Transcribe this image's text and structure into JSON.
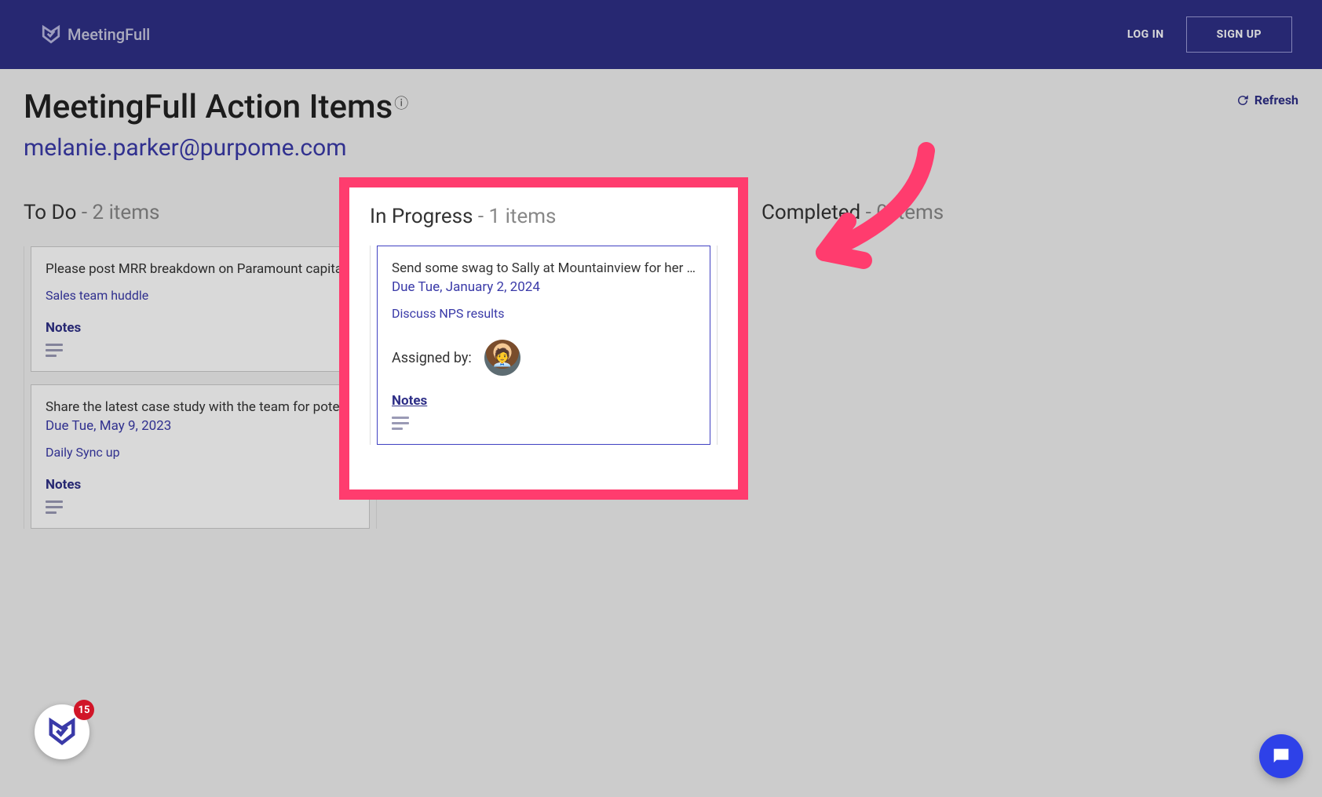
{
  "brand": "MeetingFull",
  "header": {
    "login": "LOG IN",
    "signup": "SIGN UP"
  },
  "page_title": "MeetingFull Action Items",
  "refresh_label": "Refresh",
  "email": "melanie.parker@purpome.com",
  "columns": {
    "todo": {
      "name": "To Do",
      "count_label": " - 2 items",
      "cards": [
        {
          "title": "Please post MRR breakdown on Paramount capital",
          "meeting": "Sales team huddle",
          "notes_label": "Notes"
        },
        {
          "title": "Share the latest case study with the team for potential us...",
          "due": "Due Tue, May 9, 2023",
          "meeting": "Daily Sync up",
          "notes_label": "Notes"
        }
      ]
    },
    "inprogress": {
      "name": "In Progress",
      "count_label": " - 1 items",
      "cards": [
        {
          "title": "Send some swag to Sally at Mountainview for her great re...",
          "due": "Due Tue, January 2, 2024",
          "meeting": "Discuss NPS results",
          "assigned_by_label": "Assigned by:",
          "notes_label": "Notes"
        }
      ]
    },
    "completed": {
      "name": "Completed",
      "count_label": " - 0 items"
    }
  },
  "fab_badge": "15"
}
